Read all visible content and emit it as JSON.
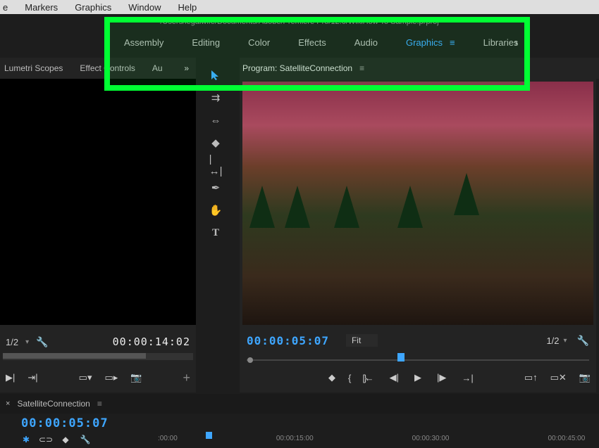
{
  "menubar": [
    "e",
    "Markers",
    "Graphics",
    "Window",
    "Help"
  ],
  "doc_path": "/Users/legalwife/Documents/Adobe/Premiere Pro/12.0/WikiHow To Sample.prproj",
  "workspaces": {
    "items": [
      "Assembly",
      "Editing",
      "Color",
      "Effects",
      "Audio",
      "Graphics",
      "Libraries"
    ],
    "active_index": 5
  },
  "left_panel_tabs": [
    "Lumetri Scopes",
    "Effect Controls",
    "Audio"
  ],
  "left_panel_trunc": "trols",
  "left_panel_au": "Au",
  "program_header": "Program: SatelliteConnection",
  "source": {
    "zoom": "1/2",
    "timecode": "00:00:14:02"
  },
  "program": {
    "timecode": "00:00:05:07",
    "fit_label": "Fit",
    "zoom": "1/2"
  },
  "timeline": {
    "sequence_name": "SatelliteConnection",
    "timecode": "00:00:05:07",
    "ruler": [
      ":00:00",
      "00:00:15:00",
      "00:00:30:00",
      "00:00:45:00"
    ]
  },
  "icons": {
    "marker": "◆",
    "inpoint": "{",
    "outpoint": "}",
    "goto_in": "|◀◀",
    "step_back": "◀|",
    "play": "▶",
    "step_fwd": "|▶",
    "goto_out": "▶▶|",
    "lift": "▭",
    "extract": "▣",
    "export_frame": "📷",
    "insert": "➕",
    "overwrite": "➡",
    "snapshot": "📷",
    "add": "+",
    "play_small": "▶|",
    "mark_clip": "⇥",
    "wrench": "🔧"
  }
}
